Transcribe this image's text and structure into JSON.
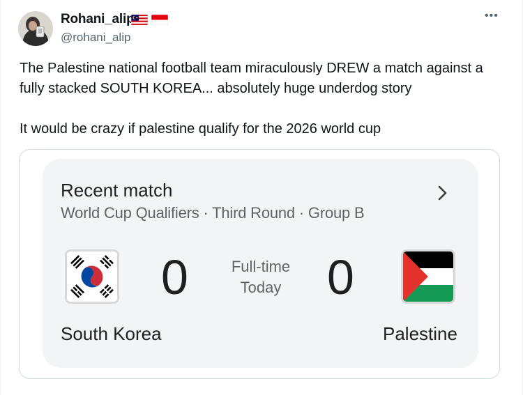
{
  "user": {
    "display_name": "Rohani_alip",
    "handle": "@rohani_alip",
    "name_flags": [
      "flag-malaysia-icon",
      "flag-indonesia-icon"
    ]
  },
  "menu_label": "•••",
  "tweet": {
    "line1": "The Palestine national football team miraculously DREW a match against a fully stacked SOUTH KOREA... absolutely huge underdog story",
    "line2": "It would be crazy if palestine qualify for the 2026 world cup"
  },
  "match_card": {
    "title": "Recent match",
    "subtitle": "World Cup Qualifiers · Third Round · Group B",
    "status": "Full-time",
    "date": "Today",
    "home": {
      "name": "South Korea",
      "score": "0",
      "flag": "flag-south-korea-icon"
    },
    "away": {
      "name": "Palestine",
      "score": "0",
      "flag": "flag-palestine-icon"
    }
  },
  "colors": {
    "text_primary": "#0f1419",
    "text_secondary": "#536471",
    "card_background": "#f3f4f6",
    "border": "#cfd9de"
  }
}
